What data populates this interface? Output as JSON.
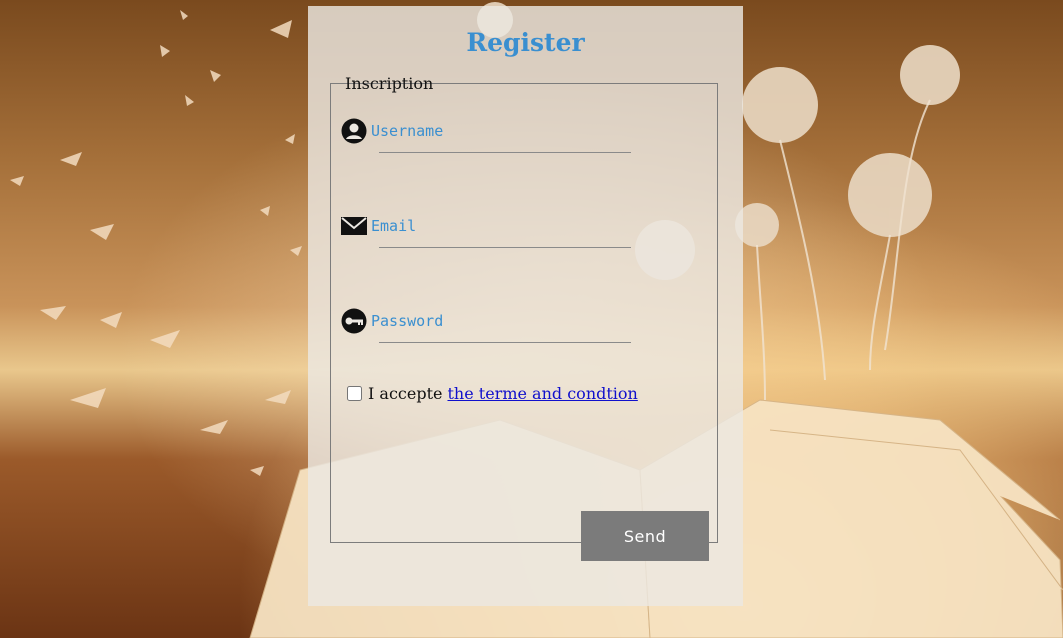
{
  "form": {
    "title": "Register",
    "legend": "Inscription",
    "fields": [
      {
        "icon": "user-icon",
        "placeholder": "Username"
      },
      {
        "icon": "mail-icon",
        "placeholder": "Email"
      },
      {
        "icon": "key-icon",
        "placeholder": "Password"
      }
    ],
    "terms": {
      "prefix": "I accepte",
      "link_text": "the terme and condtion",
      "checked": false
    },
    "submit_label": "Send"
  },
  "colors": {
    "accent": "#3a8fd0",
    "button": "#7b7b7b"
  }
}
